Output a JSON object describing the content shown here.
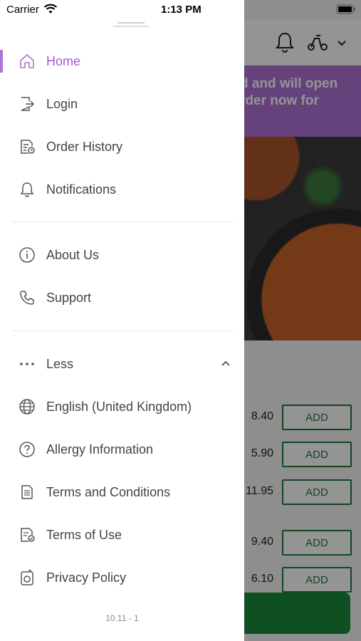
{
  "status_bar": {
    "carrier": "Carrier",
    "time": "1:13 PM"
  },
  "drawer": {
    "logo_text": "",
    "menu": [
      {
        "label": "Home",
        "icon": "home-icon",
        "active": true
      },
      {
        "label": "Login",
        "icon": "login-icon"
      },
      {
        "label": "Order History",
        "icon": "order-history-icon"
      },
      {
        "label": "Notifications",
        "icon": "bell-icon"
      },
      {
        "label": "About Us",
        "icon": "info-icon"
      },
      {
        "label": "Support",
        "icon": "phone-icon"
      },
      {
        "label": "Less",
        "icon": "more-dots-icon"
      },
      {
        "label": "English (United Kingdom)",
        "icon": "globe-icon"
      },
      {
        "label": "Allergy Information",
        "icon": "help-circle-icon"
      },
      {
        "label": "Terms and Conditions",
        "icon": "document-icon"
      },
      {
        "label": "Terms of Use",
        "icon": "document-check-icon"
      },
      {
        "label": "Privacy Policy",
        "icon": "privacy-icon"
      }
    ],
    "version": "10.11 - 1"
  },
  "background": {
    "banner_line1": "d and will open",
    "banner_line2": "rder now for",
    "items": [
      {
        "price": "8.40",
        "button": "ADD"
      },
      {
        "price": "5.90",
        "button": "ADD"
      },
      {
        "price": "11.95",
        "button": "ADD"
      },
      {
        "price": "9.40",
        "button": "ADD"
      },
      {
        "price": "6.10",
        "button": "ADD"
      }
    ]
  },
  "colors": {
    "accent": "#b073d6",
    "add_green": "#1f7a3a"
  }
}
